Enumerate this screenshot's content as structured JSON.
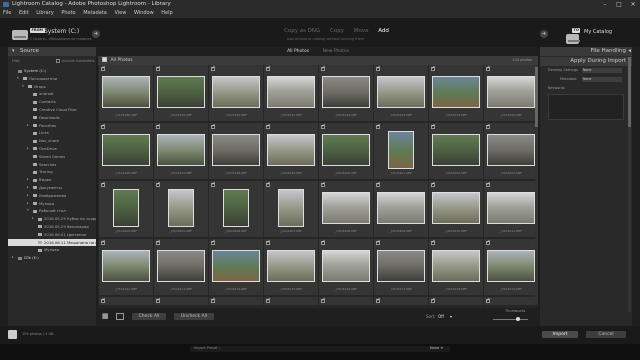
{
  "window": {
    "title": "Lightroom Catalog - Adobe Photoshop Lightroom - Library"
  },
  "menu": [
    "File",
    "Edit",
    "Library",
    "Photo",
    "Metadata",
    "View",
    "Window",
    "Help"
  ],
  "header": {
    "from_badge": "FROM",
    "source_name": "System (C:)",
    "source_path": "C:\\Users\\...\\Мешанина на грамоте",
    "modes": [
      "Copy as DNG",
      "Copy",
      "Move",
      "Add"
    ],
    "active_mode": "Add",
    "mode_desc": "Add photos to catalog without moving them",
    "to_badge": "TO",
    "catalog_name": "My Catalog"
  },
  "left_panel": {
    "title": "Source",
    "files_label": "Files",
    "include_sub": "Include Subfolders",
    "tree": [
      {
        "label": "System (C:)",
        "indent": 0,
        "kind": "drive",
        "exp": ""
      },
      {
        "label": "Пользователи",
        "indent": 1,
        "kind": "folder",
        "exp": "▾"
      },
      {
        "label": "Игорь",
        "indent": 2,
        "kind": "folder",
        "exp": "▾"
      },
      {
        "label": "android",
        "indent": 3,
        "kind": "folder",
        "exp": ""
      },
      {
        "label": "Contacts",
        "indent": 3,
        "kind": "folder",
        "exp": ""
      },
      {
        "label": "Creative Cloud Files",
        "indent": 3,
        "kind": "folder",
        "exp": ""
      },
      {
        "label": "Downloads",
        "indent": 3,
        "kind": "folder",
        "exp": ""
      },
      {
        "label": "Favorites",
        "indent": 3,
        "kind": "folder",
        "exp": "▸"
      },
      {
        "label": "Links",
        "indent": 3,
        "kind": "folder",
        "exp": ""
      },
      {
        "label": "Nav_share",
        "indent": 3,
        "kind": "folder",
        "exp": ""
      },
      {
        "label": "OneDrive",
        "indent": 3,
        "kind": "folder",
        "exp": "▸"
      },
      {
        "label": "Saved Games",
        "indent": 3,
        "kind": "folder",
        "exp": ""
      },
      {
        "label": "Searches",
        "indent": 3,
        "kind": "folder",
        "exp": ""
      },
      {
        "label": "Tracing",
        "indent": 3,
        "kind": "folder",
        "exp": ""
      },
      {
        "label": "Видео",
        "indent": 3,
        "kind": "folder",
        "exp": "▸"
      },
      {
        "label": "Документы",
        "indent": 3,
        "kind": "folder",
        "exp": "▸"
      },
      {
        "label": "Изображения",
        "indent": 3,
        "kind": "folder",
        "exp": "▸"
      },
      {
        "label": "Музыка",
        "indent": 3,
        "kind": "folder",
        "exp": "▸"
      },
      {
        "label": "Рабочий стол",
        "indent": 3,
        "kind": "folder",
        "exp": "▾"
      },
      {
        "label": "2016.05.29 Кубок по скоростн..",
        "indent": 4,
        "kind": "folder",
        "exp": "▸"
      },
      {
        "label": "2016.05.29 Велопарад",
        "indent": 4,
        "kind": "folder",
        "exp": ""
      },
      {
        "label": "2016.06.01 Цветение",
        "indent": 4,
        "kind": "folder",
        "exp": ""
      },
      {
        "label": "2016.06.11 Мешанина на грам..",
        "indent": 4,
        "kind": "selected",
        "exp": ""
      },
      {
        "label": "Музыка",
        "indent": 4,
        "kind": "folder",
        "exp": ""
      },
      {
        "label": "DTe (E:)",
        "indent": 0,
        "kind": "drive",
        "exp": "▸"
      }
    ]
  },
  "center": {
    "tabs": [
      "All Photos",
      "New Photos"
    ],
    "grid_header": "All Photos",
    "photo_count": "104 photos",
    "photos": [
      {
        "name": "_DSC6188.NEF",
        "style": "p1",
        "o": "l"
      },
      {
        "name": "_DSC6189.NEF",
        "style": "p3",
        "o": "l"
      },
      {
        "name": "_DSC6190.NEF",
        "style": "p2",
        "o": "l"
      },
      {
        "name": "_DSC6191.NEF",
        "style": "p4",
        "o": "l"
      },
      {
        "name": "_DSC6192.NEF",
        "style": "p6",
        "o": "l"
      },
      {
        "name": "_DSC6193.NEF",
        "style": "p2",
        "o": "l"
      },
      {
        "name": "_DSC6194.NEF",
        "style": "p5",
        "o": "l"
      },
      {
        "name": "_DSC6195.NEF",
        "style": "p4",
        "o": "l"
      },
      {
        "name": "_DSC6196.NEF",
        "style": "p3",
        "o": "l"
      },
      {
        "name": "_DSC6197.NEF",
        "style": "p1",
        "o": "l"
      },
      {
        "name": "_DSC6198.NEF",
        "style": "p6",
        "o": "l"
      },
      {
        "name": "_DSC6199.NEF",
        "style": "p2",
        "o": "l"
      },
      {
        "name": "_DSC6200.NEF",
        "style": "p3",
        "o": "l"
      },
      {
        "name": "_DSC6201.NEF",
        "style": "p5",
        "o": "p"
      },
      {
        "name": "_DSC6202.NEF",
        "style": "p3",
        "o": "l"
      },
      {
        "name": "_DSC6203.NEF",
        "style": "p6",
        "o": "l"
      },
      {
        "name": "_DSC6204.NEF",
        "style": "p3",
        "o": "p"
      },
      {
        "name": "_DSC6205.NEF",
        "style": "p2",
        "o": "p"
      },
      {
        "name": "_DSC6206.NEF",
        "style": "p3",
        "o": "p"
      },
      {
        "name": "_DSC6207.NEF",
        "style": "p2",
        "o": "p"
      },
      {
        "name": "_DSC6208.NEF",
        "style": "p4",
        "o": "l"
      },
      {
        "name": "_DSC6209.NEF",
        "style": "p4",
        "o": "l"
      },
      {
        "name": "_DSC6210.NEF",
        "style": "p2",
        "o": "l"
      },
      {
        "name": "_DSC6211.NEF",
        "style": "p4",
        "o": "l"
      },
      {
        "name": "_DSC6212.NEF",
        "style": "p1",
        "o": "l"
      },
      {
        "name": "_DSC6213.NEF",
        "style": "p6",
        "o": "l"
      },
      {
        "name": "_DSC6214.NEF",
        "style": "p5",
        "o": "l"
      },
      {
        "name": "_DSC6215.NEF",
        "style": "p2",
        "o": "l"
      },
      {
        "name": "_DSC6216.NEF",
        "style": "p4",
        "o": "l"
      },
      {
        "name": "_DSC6217.NEF",
        "style": "p6",
        "o": "l"
      },
      {
        "name": "_DSC6218.NEF",
        "style": "p2",
        "o": "l"
      },
      {
        "name": "_DSC6219.NEF",
        "style": "p1",
        "o": "l"
      },
      {
        "name": "_DSC6220.NEF",
        "style": "p6",
        "o": "l"
      },
      {
        "name": "_DSC6221.NEF",
        "style": "p3",
        "o": "l"
      },
      {
        "name": "_DSC6222.NEF",
        "style": "p4",
        "o": "l"
      },
      {
        "name": "_DSC6223.NEF",
        "style": "p2",
        "o": "l"
      },
      {
        "name": "_DSC6224.NEF",
        "style": "p1",
        "o": "l"
      },
      {
        "name": "_DSC6225.NEF",
        "style": "p3",
        "o": "l"
      },
      {
        "name": "_DSC6226.NEF",
        "style": "p2",
        "o": "l"
      },
      {
        "name": "_DSC6227.NEF",
        "style": "p6",
        "o": "l"
      }
    ],
    "check_all": "Check All",
    "uncheck_all": "Uncheck All",
    "sort_label": "Sort:",
    "sort_value": "Off",
    "thumbnails_label": "Thumbnails"
  },
  "right_panel": {
    "file_handling": "File Handling",
    "apply_during": "Apply During Import",
    "develop_label": "Develop Settings",
    "develop_value": "None",
    "metadata_label": "Metadata",
    "metadata_value": "None",
    "keywords_label": "Keywords"
  },
  "footer": {
    "info": "104 photos / 4 GB",
    "preset_label": "Import Preset :",
    "preset_value": "None",
    "import_btn": "Import",
    "cancel_btn": "Cancel"
  }
}
